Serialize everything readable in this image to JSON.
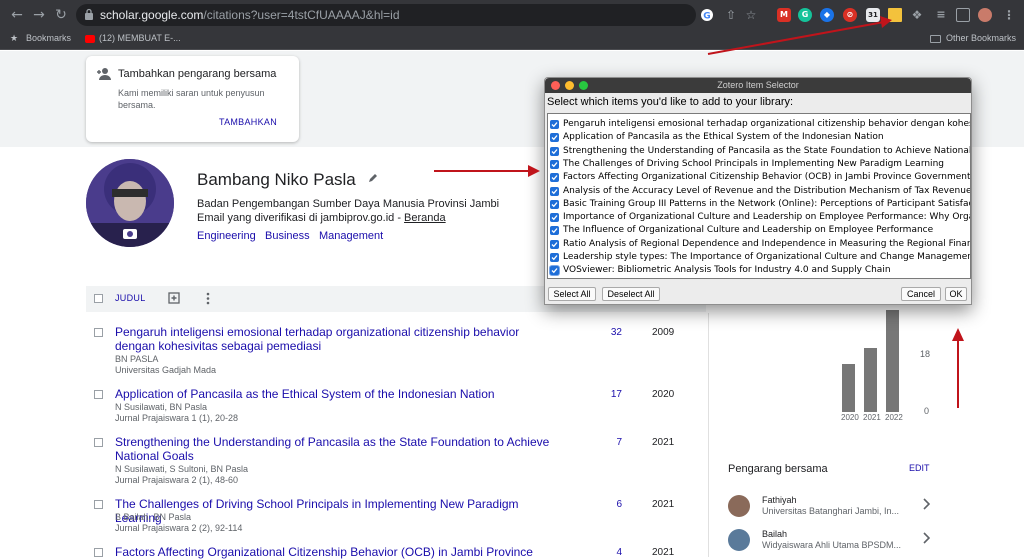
{
  "browser": {
    "url_host": "scholar.google.com",
    "url_path": "/citations?user=4tstCfUAAAAJ&hl=id",
    "bookmarks_label": "Bookmarks",
    "bookmark_item": "(12) MEMBUAT E-...",
    "other_bookmarks": "Other Bookmarks",
    "extension_badge": "31"
  },
  "coauthor_card": {
    "title": "Tambahkan pengarang bersama",
    "description": "Kami memiliki saran untuk penyusun bersama.",
    "action": "TAMBAHKAN"
  },
  "profile": {
    "name": "Bambang Niko Pasla",
    "affiliation": "Badan Pengembangan Sumber Daya Manusia Provinsi Jambi",
    "email_text": "Email yang diverifikasi di jambiprov.go.id - ",
    "homepage_link": "Beranda",
    "interests": [
      "Engineering",
      "Business",
      "Management"
    ]
  },
  "table": {
    "header_label": "JUDUL",
    "rows": [
      {
        "title": "Pengaruh inteligensi emosional terhadap organizational citizenship behavior dengan kohesivitas sebagai pemediasi",
        "authors": "BN PASLA",
        "venue": "Universitas Gadjah Mada",
        "cited": "32",
        "year": "2009"
      },
      {
        "title": "Application of Pancasila as the Ethical System of the Indonesian Nation",
        "authors": "N Susilawati, BN Pasla",
        "venue": "Jurnal Prajaiswara 1 (1), 20-28",
        "cited": "17",
        "year": "2020"
      },
      {
        "title": "Strengthening the Understanding of Pancasila as the State Foundation to Achieve National Goals",
        "authors": "N Susilawati, S Sultoni, BN Pasla",
        "venue": "Jurnal Prajaiswara 2 (1), 48-60",
        "cited": "7",
        "year": "2021"
      },
      {
        "title": "The Challenges of Driving School Principals in Implementing New Paradigm Learning",
        "authors": "B Bailah, BN Pasla",
        "venue": "Jurnal Prajaiswara 2 (2), 92-114",
        "cited": "6",
        "year": "2021"
      },
      {
        "title": "Factors Affecting Organizational Citizenship Behavior (OCB) in Jambi Province",
        "authors": "",
        "venue": "",
        "cited": "4",
        "year": "2021"
      }
    ]
  },
  "citations_chart": {
    "y_ticks": [
      "18",
      "0"
    ],
    "chart_data": {
      "type": "bar",
      "categories": [
        "2020",
        "2021",
        "2022"
      ],
      "values": [
        18,
        24,
        38
      ],
      "ylim": [
        0,
        38
      ]
    }
  },
  "coauthors": {
    "title": "Pengarang bersama",
    "edit_label": "EDIT",
    "people": [
      {
        "name": "Fathiyah",
        "affiliation": "Universitas Batanghari Jambi, In..."
      },
      {
        "name": "Bailah",
        "affiliation": "Widyaiswara Ahli Utama BPSDM..."
      }
    ]
  },
  "dialog": {
    "title": "Zotero Item Selector",
    "prompt": "Select which items you'd like to add to your library:",
    "items": [
      "Pengaruh inteligensi emosional terhadap organizational citizenship behavior dengan kohesivitas sebagai pemediasi",
      "Application of Pancasila as the Ethical System of the Indonesian Nation",
      "Strengthening the Understanding of Pancasila as the State Foundation to Achieve National Goals",
      "The Challenges of Driving School Principals in Implementing New Paradigm Learning",
      "Factors Affecting Organizational Citizenship Behavior (OCB) in Jambi Province Government Employees",
      "Analysis of the Accuracy Level of Revenue and the Distribution Mechanism of Tax Revenue Sharing",
      "Basic Training Group III Patterns in the Network (Online): Perceptions of Participant Satisfaction and",
      "Importance of Organizational Culture and Leadership on Employee Performance: Why Organizational",
      "The Influence of Organizational Culture and Leadership on Employee Performance",
      "Ratio Analysis of Regional Dependence and Independence in Measuring the Regional Financial Capacity",
      "Leadership style types: The Importance of Organizational Culture and Change Management",
      "VOSviewer: Bibliometric Analysis Tools for Industry 4.0 and Supply Chain"
    ],
    "select_all": "Select All",
    "deselect_all": "Deselect All",
    "cancel": "Cancel",
    "ok": "OK"
  },
  "colors": {
    "annotation_arrow": "#c0141b",
    "checkbox_blue": "#1e6ed8",
    "link_blue": "#1a0dab"
  }
}
